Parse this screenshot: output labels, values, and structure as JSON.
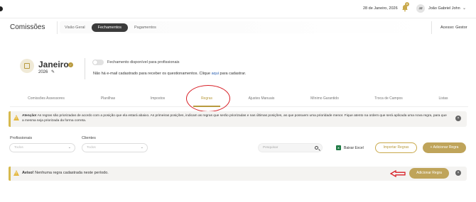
{
  "topbar": {
    "date": "28 de Janeiro, 2026",
    "bell_count": "6",
    "avatar_initials": "JJ",
    "user_name": "João Gabriel John"
  },
  "header": {
    "title": "Comissões",
    "tabs": [
      {
        "label": "Visão Geral",
        "active": false
      },
      {
        "label": "Fechamentos",
        "active": true
      },
      {
        "label": "Pagamentos",
        "active": false
      }
    ],
    "access": "Acesso: Gestor"
  },
  "period": {
    "month": "Janeiro",
    "year": "2026",
    "toggle_label": "Fechamento disponível para profissionais",
    "email_msg_pre": "Não há e-mail cadastrado para receber os questionamentos. Clique ",
    "email_link": "aqui",
    "email_msg_post": " para cadastrar."
  },
  "tabs": [
    {
      "label": "Comissões Assessores",
      "active": false
    },
    {
      "label": "Planilhas",
      "active": false
    },
    {
      "label": "Impostos",
      "active": false
    },
    {
      "label": "Regras",
      "active": true
    },
    {
      "label": "Ajustes Manuais",
      "active": false
    },
    {
      "label": "Mínimo Garantido",
      "active": false
    },
    {
      "label": "Troca de Campos",
      "active": false
    },
    {
      "label": "Listas",
      "active": false
    }
  ],
  "attention": {
    "bold": "Atenção!",
    "text": " As regras são priorizadas de acordo com a posição que ela estará abaixo. As primeiras posições, indicam as regras que serão priorizadas e nas últimas posições, as que possuem uma prioridade menor. Fique atento na ordem que será aplicada uma nova regra, para que a mesma seja priorizada da forma correta."
  },
  "filters": {
    "professionals_label": "Profissionais",
    "professionals_placeholder": "Todos",
    "clients_label": "Clientes",
    "clients_placeholder": "Todos",
    "search_placeholder": "Pesquisar",
    "excel_label": "Baixar Excel",
    "import_label": "Importar Regras",
    "add_label": "+ Adicionar Regra"
  },
  "notice": {
    "bold": "Aviso!",
    "text": " Nenhuma regra cadastrada neste período.",
    "button": "Adicionar Regra"
  },
  "colors": {
    "accent": "#bfa45a",
    "annotation_red": "#d81f26"
  }
}
